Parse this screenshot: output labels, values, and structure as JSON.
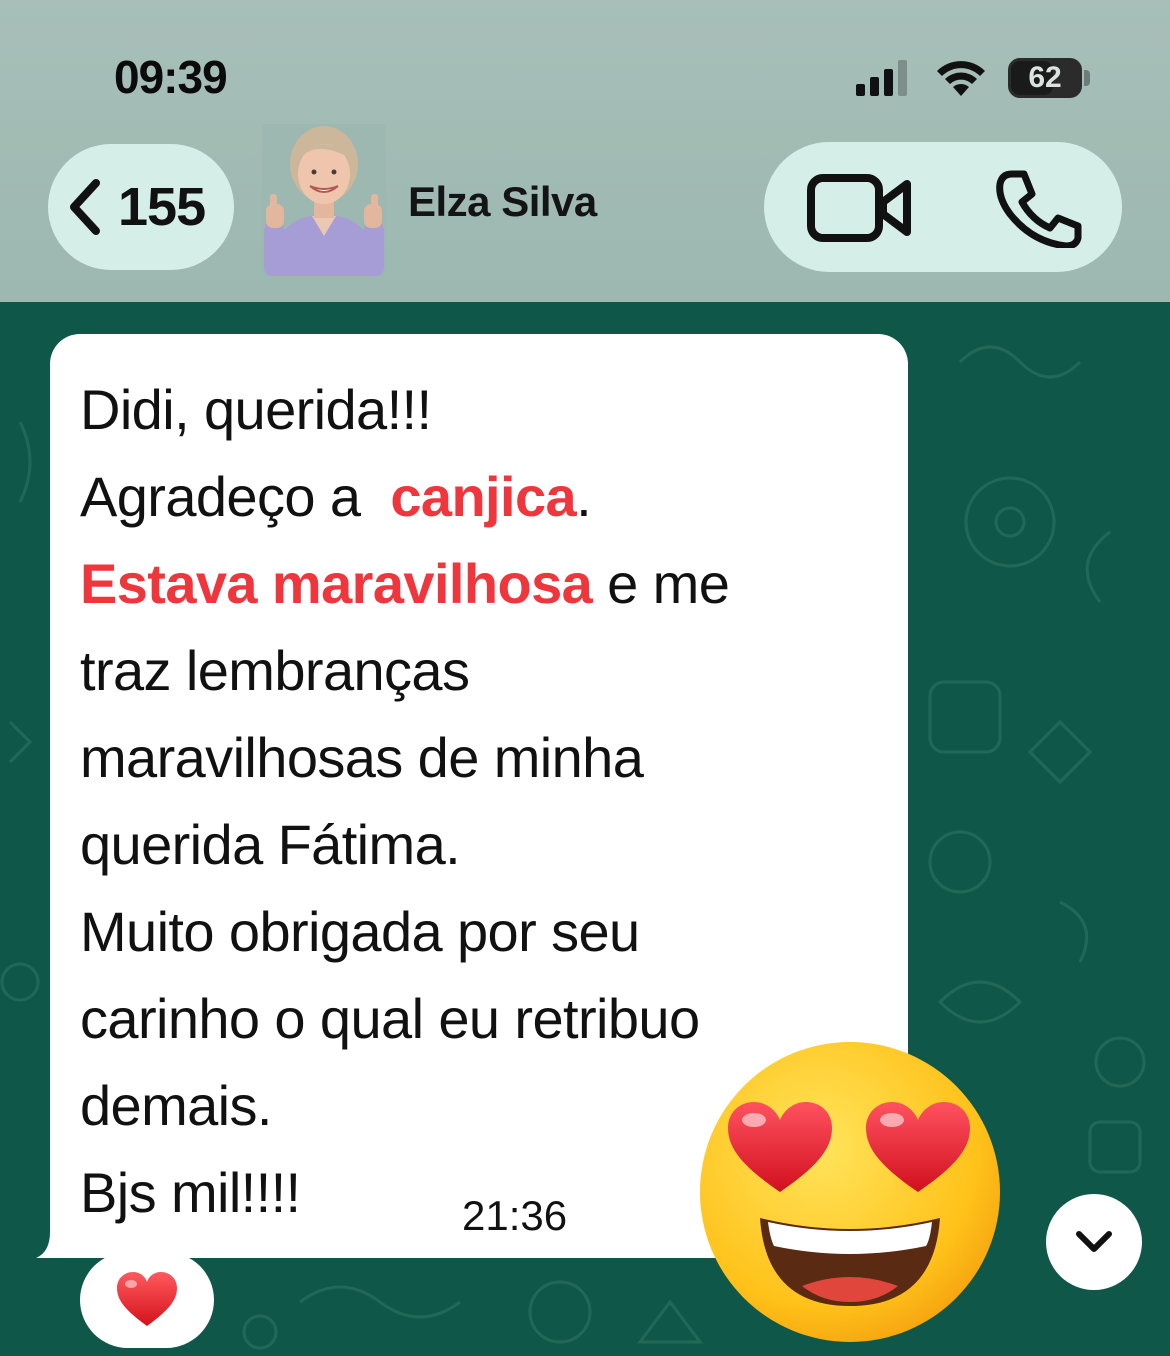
{
  "status_bar": {
    "time": "09:39",
    "battery": "62",
    "battery_level_percent": 62
  },
  "header": {
    "back_count": "155",
    "contact_name": "Elza Silva",
    "icons": [
      "back-chevron-icon",
      "video-call-icon",
      "phone-call-icon"
    ]
  },
  "message": {
    "lines": {
      "l1": "Didi, querida!!!",
      "l2a": "Agradeço a ",
      "l2b": "canjica",
      "l2c": ".",
      "l3a": "Estava maravilhosa",
      "l3b": " e me",
      "l4": "traz lembranças",
      "l5": "maravilhosas de minha",
      "l6": "querida Fátima.",
      "l7": "Muito obrigada por seu",
      "l8": "carinho o qual eu retribuo",
      "l9": "demais.",
      "l10": "Bjs mil!!!!"
    },
    "time": "21:36",
    "highlight_color": "#f0363d",
    "reaction": "heart-icon",
    "sticker": "heart-eyes-emoji"
  },
  "colors": {
    "header_bg": "#a7bfb8",
    "pill_bg": "#d6eee8",
    "chat_bg": "#0f5849",
    "bubble_bg": "#ffffff"
  }
}
